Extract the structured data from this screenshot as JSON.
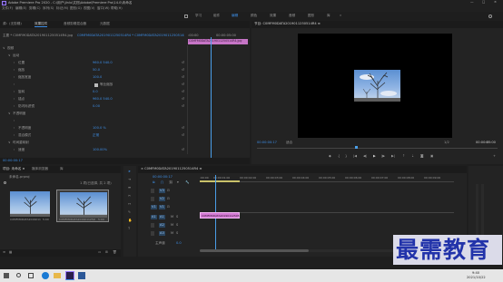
{
  "titlebar": {
    "title": "Adobe Premiere Pro 2020 - C:\\用户\\Jinlu\\文档\\Adobe\\Premiere Pro\\14.0\\未命名"
  },
  "menubar": {
    "items": [
      "文件(F)",
      "编辑(E)",
      "剪辑(C)",
      "序列(S)",
      "标记(M)",
      "图形(G)",
      "视图(V)",
      "窗口(W)",
      "帮助(H)"
    ]
  },
  "workspaces": {
    "items": [
      "学习",
      "组件",
      "编辑",
      "颜色",
      "效果",
      "音频",
      "图形",
      "库"
    ],
    "active": "编辑"
  },
  "effect_controls": {
    "tabs": [
      "源：(无剪辑)",
      "效果控件",
      "音频剪辑混合器",
      "元数据"
    ],
    "source_label": "主要 * C0MFM0DATA2019011250514R4.jpg",
    "clip_label": "C0MFM0DATA2019011250514R4 * C0MFM0DATA2019011250514R4...",
    "timecode_start": ":00:00",
    "timecode_end": "00:00:05:00",
    "clip_bar": "C0MFM0DATA2019011250514R4.jpg",
    "sections": [
      {
        "label": "视频",
        "indent": 0
      },
      {
        "label": "运动",
        "indent": 1
      },
      {
        "label": "位置",
        "indent": 2,
        "value": "960.0    540.0"
      },
      {
        "label": "缩放",
        "indent": 2,
        "value": "50.0"
      },
      {
        "label": "缩放宽度",
        "indent": 2,
        "value": "100.0"
      },
      {
        "label": "",
        "indent": 2,
        "value": "等比缩放",
        "checkbox": true
      },
      {
        "label": "旋转",
        "indent": 2,
        "value": "0.0"
      },
      {
        "label": "锚点",
        "indent": 2,
        "value": "960.0    540.0"
      },
      {
        "label": "防闪烁滤镜",
        "indent": 2,
        "value": "0.00"
      },
      {
        "label": "不透明度",
        "indent": 1
      },
      {
        "label": "",
        "indent": 2,
        "value": ""
      },
      {
        "label": "不透明度",
        "indent": 2,
        "value": "100.0 %"
      },
      {
        "label": "混合模式",
        "indent": 2,
        "value": "正常"
      },
      {
        "label": "时间重映射",
        "indent": 1
      },
      {
        "label": "速度",
        "indent": 2,
        "value": "100.00%"
      }
    ],
    "footer_time": "00:00:00:17"
  },
  "program": {
    "title": "节目: C0MFM0DATA2019011250514R4 ≡",
    "timecode": "00:00:00:17",
    "fit": "适合",
    "scale": "1/2",
    "duration": "00:00:05:00"
  },
  "project": {
    "tabs": [
      "项目: 未命名 ≡",
      "媒体浏览器",
      "库"
    ],
    "name": "未命名.prproj",
    "count": "1 项(已选择, 共 2 项)",
    "items": [
      {
        "name": "C0MFM0DATA2019011250514R4.jpg",
        "duration": "5:00"
      },
      {
        "name": "C0MFM0DATA2019011250514R4",
        "duration": "5:00"
      }
    ]
  },
  "timeline": {
    "tab": "× C0MFM0DATA2019011250514R4 ≡",
    "timecode": "00:00:00:17",
    "ruler": [
      ":00:00",
      "00:00:01:00",
      "00:00:02:00",
      "00:00:03:00",
      "00:00:04:00",
      "00:00:05:00",
      "00:00:06:00",
      "00:00:07:00",
      "00:00:08:00",
      "00:00:09:00"
    ],
    "tracks": [
      "V3",
      "V2",
      "V1",
      "A1",
      "A2",
      "A3"
    ],
    "master": "主声道",
    "master_value": "0.0",
    "clip_label": "C0MFM0DATA2019011250514R4.jpg"
  },
  "watermark": {
    "text": "最需教育"
  },
  "taskbar": {
    "time": "9:40",
    "date": "2021/10/22"
  },
  "colors": {
    "accent": "#3d8ee6",
    "clip": "#d47ad4",
    "playhead": "#4a9ee8"
  }
}
